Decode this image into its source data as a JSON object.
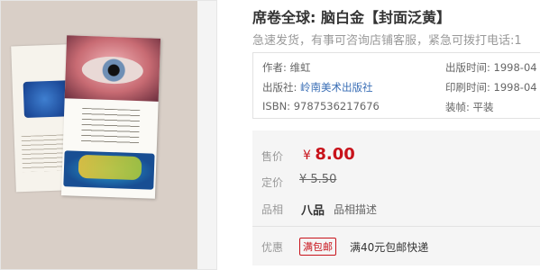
{
  "product": {
    "title": "席卷全球: 脑白金【封面泛黄】",
    "subtitle": "急速发货，有事可咨询店铺客服，紧急可拨打电话:1"
  },
  "info": {
    "author_label": "作者:",
    "author": "维虹",
    "publisher_label": "出版社:",
    "publisher": "岭南美术出版社",
    "isbn_label": "ISBN:",
    "isbn": "9787536217676",
    "pub_date_label": "出版时间:",
    "pub_date": "1998-04",
    "print_date_label": "印刷时间:",
    "print_date": "1998-04",
    "binding_label": "装帧:",
    "binding": "平装"
  },
  "price": {
    "sale_label": "售价",
    "currency": "¥",
    "sale_value": "8.00",
    "original_label": "定价",
    "original": "¥ 5.50",
    "quality_label": "品相",
    "quality": "八品",
    "quality_desc": "品相描述"
  },
  "promo": {
    "label": "优惠",
    "tag": "满包邮",
    "text": "满40元包邮快递"
  },
  "colors": {
    "price_red": "#c8131b",
    "link_blue": "#3b6fb6",
    "muted": "#999999"
  }
}
